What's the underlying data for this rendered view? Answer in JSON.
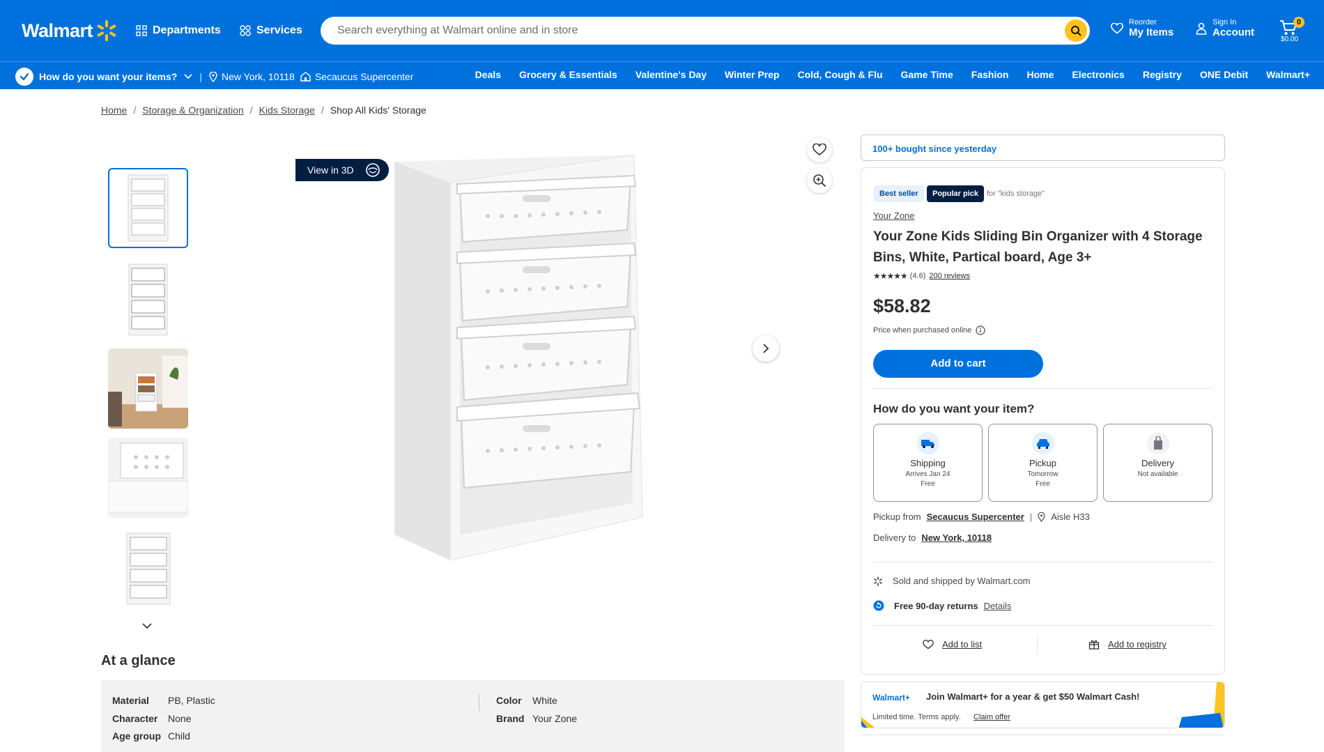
{
  "header": {
    "logo_text": "Walmart",
    "departments": "Departments",
    "services": "Services",
    "search_placeholder": "Search everything at Walmart online and in store",
    "reorder_small": "Reorder",
    "reorder_big": "My Items",
    "signin_small": "Sign In",
    "signin_big": "Account",
    "cart_count": "0",
    "cart_total": "$0.00"
  },
  "subbar": {
    "how": "How do you want your items?",
    "location": "New York, 10118",
    "store": "Secaucus Supercenter",
    "nav": [
      "Deals",
      "Grocery & Essentials",
      "Valentine's Day",
      "Winter Prep",
      "Cold, Cough & Flu",
      "Game Time",
      "Fashion",
      "Home",
      "Electronics",
      "Registry",
      "ONE Debit",
      "Walmart+"
    ]
  },
  "breadcrumb": {
    "items": [
      "Home",
      "Storage & Organization",
      "Kids Storage"
    ],
    "current": "Shop All Kids' Storage"
  },
  "gallery": {
    "view3d": "View in 3D"
  },
  "glance": {
    "title": "At a glance",
    "rows": [
      {
        "k": "Material",
        "v": "PB, Plastic"
      },
      {
        "k": "Character",
        "v": "None"
      },
      {
        "k": "Age group",
        "v": "Child"
      },
      {
        "k": "Color",
        "v": "White"
      },
      {
        "k": "Brand",
        "v": "Your Zone"
      }
    ]
  },
  "product": {
    "bought": "100+ bought since yesterday",
    "badge_best": "Best seller",
    "badge_pop": "Popular pick",
    "badge_for": "for \"kids storage\"",
    "brand": "Your Zone",
    "title": "Your Zone Kids Sliding Bin Organizer with 4 Storage Bins, White, Partical board, Age 3+",
    "stars": "★★★★★",
    "rating": "(4.6)",
    "reviews": "200 reviews",
    "price": "$58.82",
    "price_note": "Price when purchased online",
    "add_to_cart": "Add to cart",
    "how_title": "How do you want your item?",
    "options": [
      {
        "name": "Shipping",
        "line1": "Arrives Jan 24",
        "line2": "Free"
      },
      {
        "name": "Pickup",
        "line1": "Tomorrow",
        "line2": "Free"
      },
      {
        "name": "Delivery",
        "line1": "Not available",
        "line2": ""
      }
    ],
    "pickup_from": "Pickup from",
    "pickup_store": "Secaucus Supercenter",
    "aisle": "Aisle H33",
    "delivery_to": "Delivery to",
    "delivery_loc": "New York, 10118",
    "sold_by": "Sold and shipped by Walmart.com",
    "returns": "Free 90-day returns",
    "returns_link": "Details",
    "add_to_list": "Add to list",
    "add_to_registry": "Add to registry"
  },
  "walmart_plus": {
    "logo": "Walmart+",
    "message": "Join Walmart+ for a year & get $50 Walmart Cash!",
    "fine": "Limited time. Terms apply.",
    "claim": "Claim offer"
  },
  "colors": {
    "brand_blue": "#0071dc",
    "spark_yellow": "#ffc220",
    "navy": "#041e42"
  }
}
